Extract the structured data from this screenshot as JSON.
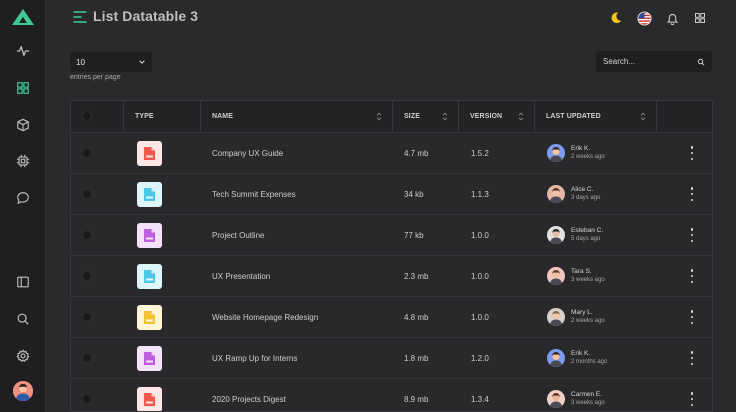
{
  "header": {
    "title": "List Datatable 3"
  },
  "controls": {
    "entries_value": "10",
    "entries_label": "entries per page",
    "search_placeholder": "Search..."
  },
  "table": {
    "columns": [
      "TYPE",
      "NAME",
      "SIZE",
      "VERSION",
      "LAST UPDATED"
    ],
    "rows": [
      {
        "type": "pdf",
        "name": "Company UX Guide",
        "size": "4.7 mb",
        "version": "1.5.2",
        "user": "Erik K.",
        "updated": "2 weeks ago"
      },
      {
        "type": "xls",
        "name": "Tech Summit Expenses",
        "size": "34 kb",
        "version": "1.1.3",
        "user": "Alice C.",
        "updated": "3 days ago"
      },
      {
        "type": "doc",
        "name": "Project Outline",
        "size": "77 kb",
        "version": "1.0.0",
        "user": "Esteban C.",
        "updated": "5 days ago"
      },
      {
        "type": "ppt",
        "name": "UX Presentation",
        "size": "2.3 mb",
        "version": "1.0.0",
        "user": "Tara S.",
        "updated": "3 weeks ago"
      },
      {
        "type": "img",
        "name": "Website Homepage Redesign",
        "size": "4.8 mb",
        "version": "1.0.0",
        "user": "Mary L.",
        "updated": "2 weeks ago"
      },
      {
        "type": "doc",
        "name": "UX Ramp Up for Interns",
        "size": "1.8 mb",
        "version": "1.2.0",
        "user": "Erik K.",
        "updated": "2 months ago"
      },
      {
        "type": "pdf",
        "name": "2020 Projects Digest",
        "size": "8.9 mb",
        "version": "1.3.4",
        "user": "Carmen E.",
        "updated": "3 weeks ago"
      }
    ]
  },
  "colors": {
    "accent": "#3ec995",
    "pdf": "#f2574e",
    "xls": "#4ac9e6",
    "doc": "#c05ee0",
    "ppt": "#4ac9e6",
    "img": "#f1c232"
  }
}
